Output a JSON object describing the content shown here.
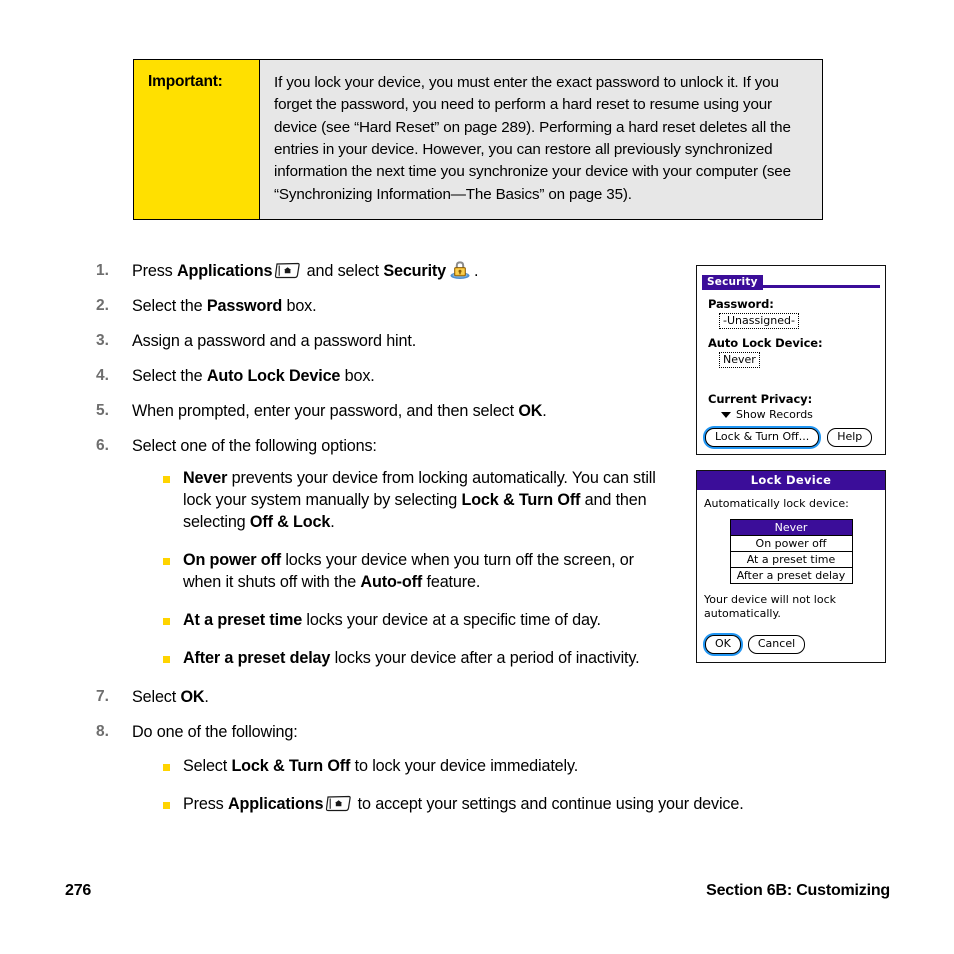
{
  "callout": {
    "label": "Important:",
    "body": "If you lock your device, you must enter the exact password to unlock it. If you forget the password, you need to perform a hard reset to resume using your device (see “Hard Reset” on page 289). Performing a hard reset deletes all the entries in your device. However, you can restore all previously synchronized information the next time you synchronize your device with your computer (see “Synchronizing Information—The Basics” on page 35).",
    "label_bg": "#FFE000",
    "body_bg": "#E7E7E7"
  },
  "steps": {
    "n1": "1.",
    "n2": "2.",
    "n3": "3.",
    "n4": "4.",
    "n5": "5.",
    "n6": "6.",
    "n7": "7.",
    "n8": "8.",
    "s1_a": "Press ",
    "s1_b": "Applications",
    "s1_c": " and select ",
    "s1_d": "Security",
    "s1_e": ".",
    "s2_a": "Select the ",
    "s2_b": "Password",
    "s2_c": " box.",
    "s3": "Assign a password and a password hint.",
    "s4_a": "Select the ",
    "s4_b": "Auto Lock Device",
    "s4_c": " box.",
    "s5_a": "When prompted, enter your password, and then select ",
    "s5_b": "OK",
    "s5_c": ".",
    "s6": "Select one of the following options:",
    "s7_a": "Select ",
    "s7_b": "OK",
    "s7_c": ".",
    "s8": "Do one of the following:"
  },
  "options": [
    {
      "bold1": "Never",
      "text1": " prevents your device from locking automatically. You can still lock your system manually by selecting ",
      "bold2": "Lock & Turn Off",
      "text2": " and then selecting ",
      "bold3": "Off & Lock",
      "text3": "."
    },
    {
      "bold1": "On power off",
      "text1": " locks your device when you turn off the screen, or when it shuts off with the ",
      "bold2": "Auto-off",
      "text2": " feature.",
      "bold3": "",
      "text3": ""
    },
    {
      "bold1": "At a preset time",
      "text1": " locks your device at a specific time of day.",
      "bold2": "",
      "text2": "",
      "bold3": "",
      "text3": ""
    },
    {
      "bold1": "After a preset delay",
      "text1": " locks your device after a period of inactivity.",
      "bold2": "",
      "text2": "",
      "bold3": "",
      "text3": ""
    }
  ],
  "final_options": [
    {
      "a": "Select ",
      "bold": "Lock & Turn Off",
      "b": " to lock your device immediately."
    },
    {
      "a": "Press ",
      "bold": "Applications",
      "b": " to accept your settings and continue using your device."
    }
  ],
  "security_screen": {
    "title": "Security",
    "password_label": "Password:",
    "password_value": "-Unassigned-",
    "autolock_label": "Auto Lock Device:",
    "autolock_value": "Never",
    "privacy_label": "Current Privacy:",
    "privacy_value": "Show Records",
    "lock_button": "Lock & Turn Off...",
    "help_button": "Help",
    "accent": "#3B0D99",
    "focus_ring": "#2196f3"
  },
  "lock_device_screen": {
    "title": "Lock Device",
    "prompt": "Automatically lock device:",
    "options": [
      "Never",
      "On power off",
      "At a preset time",
      "After a preset delay"
    ],
    "selected_index": 0,
    "note": "Your device will not lock automatically.",
    "ok_button": "OK",
    "cancel_button": "Cancel",
    "accent": "#3B0D99"
  },
  "footer": {
    "page_number": "276",
    "section": "Section 6B: Customizing"
  },
  "icons": {
    "applications": "applications-icon",
    "security_lock": "security-lock-icon",
    "privacy_chevron": "chevron-down-icon"
  },
  "colors": {
    "step_number": "#6E6E6E",
    "bullet": "#FFD400",
    "palm_purple": "#3B0D99"
  }
}
